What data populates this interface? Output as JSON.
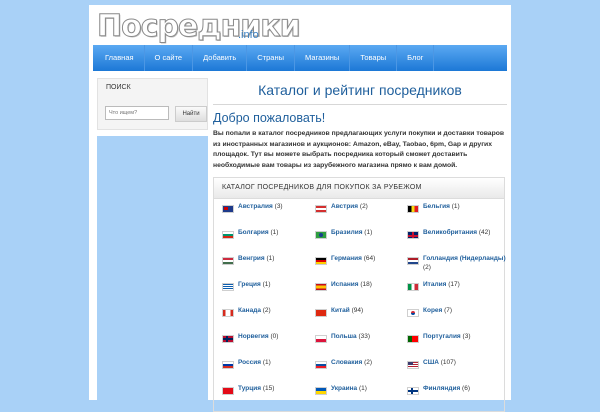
{
  "logo": {
    "main": "Посредники",
    "suffix": ".info"
  },
  "nav": [
    "Главная",
    "О сайте",
    "Добавить",
    "Страны",
    "Магазины",
    "Товары",
    "Блог"
  ],
  "sidebar": {
    "search_title": "Поиск",
    "search_placeholder": "Что ищем?",
    "search_button": "Найти"
  },
  "main": {
    "title": "Каталог и рейтинг посредников",
    "welcome": "Добро пожаловать!",
    "intro": "Вы попали в каталог посредников предлагающих услуги покупки и доставки товаров из иностранных магазинов и аукционов: Amazon, eBay, Taobao, 6pm, Gap и других площадок. Тут вы можете выбрать посредника который сможет доставить необходимые вам товары из зарубежного магазина прямо к вам домой.",
    "catalog_heading": "Каталог посредников для покупок за рубежом",
    "countries": [
      {
        "name": "Австралия",
        "count": "(3)",
        "flag": "au-flag-icon",
        "cls": "f-au"
      },
      {
        "name": "Австрия",
        "count": "(2)",
        "flag": "at-flag-icon",
        "cls": "f-at"
      },
      {
        "name": "Бельгия",
        "count": "(1)",
        "flag": "be-flag-icon",
        "cls": "f-be"
      },
      {
        "name": "Болгария",
        "count": "(1)",
        "flag": "bg-flag-icon",
        "cls": "f-bg"
      },
      {
        "name": "Бразилия",
        "count": "(1)",
        "flag": "br-flag-icon",
        "cls": "f-br"
      },
      {
        "name": "Великобритания",
        "count": "(42)",
        "flag": "gb-flag-icon",
        "cls": "f-gb"
      },
      {
        "name": "Венгрия",
        "count": "(1)",
        "flag": "hu-flag-icon",
        "cls": "f-hu"
      },
      {
        "name": "Германия",
        "count": "(64)",
        "flag": "de-flag-icon",
        "cls": "f-de"
      },
      {
        "name": "Голландия (Нидерланды)",
        "count": "(2)",
        "flag": "nl-flag-icon",
        "cls": "f-nl"
      },
      {
        "name": "Греция",
        "count": "(1)",
        "flag": "gr-flag-icon",
        "cls": "f-gr"
      },
      {
        "name": "Испания",
        "count": "(18)",
        "flag": "es-flag-icon",
        "cls": "f-es"
      },
      {
        "name": "Италия",
        "count": "(17)",
        "flag": "it-flag-icon",
        "cls": "f-it"
      },
      {
        "name": "Канада",
        "count": "(2)",
        "flag": "ca-flag-icon",
        "cls": "f-ca"
      },
      {
        "name": "Китай",
        "count": "(94)",
        "flag": "cn-flag-icon",
        "cls": "f-cn"
      },
      {
        "name": "Корея",
        "count": "(7)",
        "flag": "kr-flag-icon",
        "cls": "f-kr"
      },
      {
        "name": "Норвегия",
        "count": "(0)",
        "flag": "no-flag-icon",
        "cls": "f-no"
      },
      {
        "name": "Польша",
        "count": "(33)",
        "flag": "pl-flag-icon",
        "cls": "f-pl"
      },
      {
        "name": "Португалия",
        "count": "(3)",
        "flag": "pt-flag-icon",
        "cls": "f-pt"
      },
      {
        "name": "Россия",
        "count": "(1)",
        "flag": "ru-flag-icon",
        "cls": "f-ru"
      },
      {
        "name": "Словакия",
        "count": "(2)",
        "flag": "sk-flag-icon",
        "cls": "f-sk"
      },
      {
        "name": "США",
        "count": "(107)",
        "flag": "us-flag-icon",
        "cls": "f-us"
      },
      {
        "name": "Турция",
        "count": "(15)",
        "flag": "tr-flag-icon",
        "cls": "f-tr"
      },
      {
        "name": "Украина",
        "count": "(1)",
        "flag": "ua-flag-icon",
        "cls": "f-ua"
      },
      {
        "name": "Финляндия",
        "count": "(6)",
        "flag": "fi-flag-icon",
        "cls": "f-fi"
      }
    ]
  },
  "colors": {
    "background": "#a9d1f7",
    "nav": "#1c78d6",
    "link": "#1f5f9c"
  }
}
